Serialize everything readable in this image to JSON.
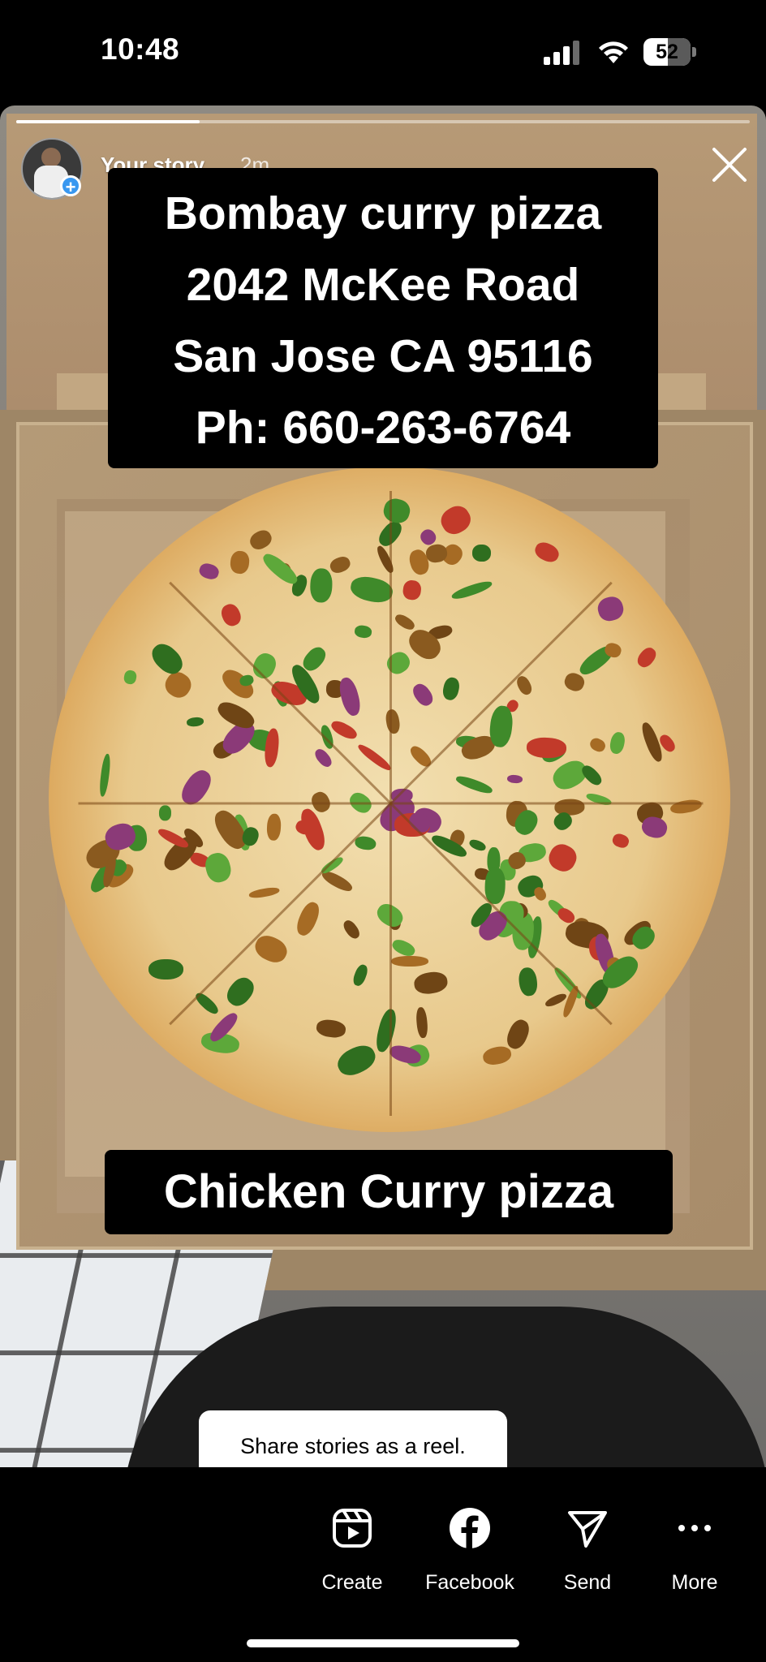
{
  "status_bar": {
    "time": "10:48",
    "battery": "52",
    "battery_level_percent": 52
  },
  "story": {
    "user": "Your story",
    "age": "2m",
    "progress_fraction": 0.25,
    "caption_top_lines": [
      "Bombay curry pizza",
      "2042 McKee Road",
      "San Jose CA 95116",
      "Ph: 660-263-6764"
    ],
    "caption_bottom": "Chicken Curry pizza"
  },
  "tooltip": {
    "text": "Share stories as a reel."
  },
  "actions": [
    {
      "label": "Create",
      "icon": "reel-create-icon"
    },
    {
      "label": "Facebook",
      "icon": "facebook-icon"
    },
    {
      "label": "Send",
      "icon": "send-icon"
    },
    {
      "label": "More",
      "icon": "more-icon"
    }
  ],
  "colors": {
    "accent": "#3897f0",
    "caption_bg": "#000000",
    "tooltip_bg": "#ffffff"
  }
}
